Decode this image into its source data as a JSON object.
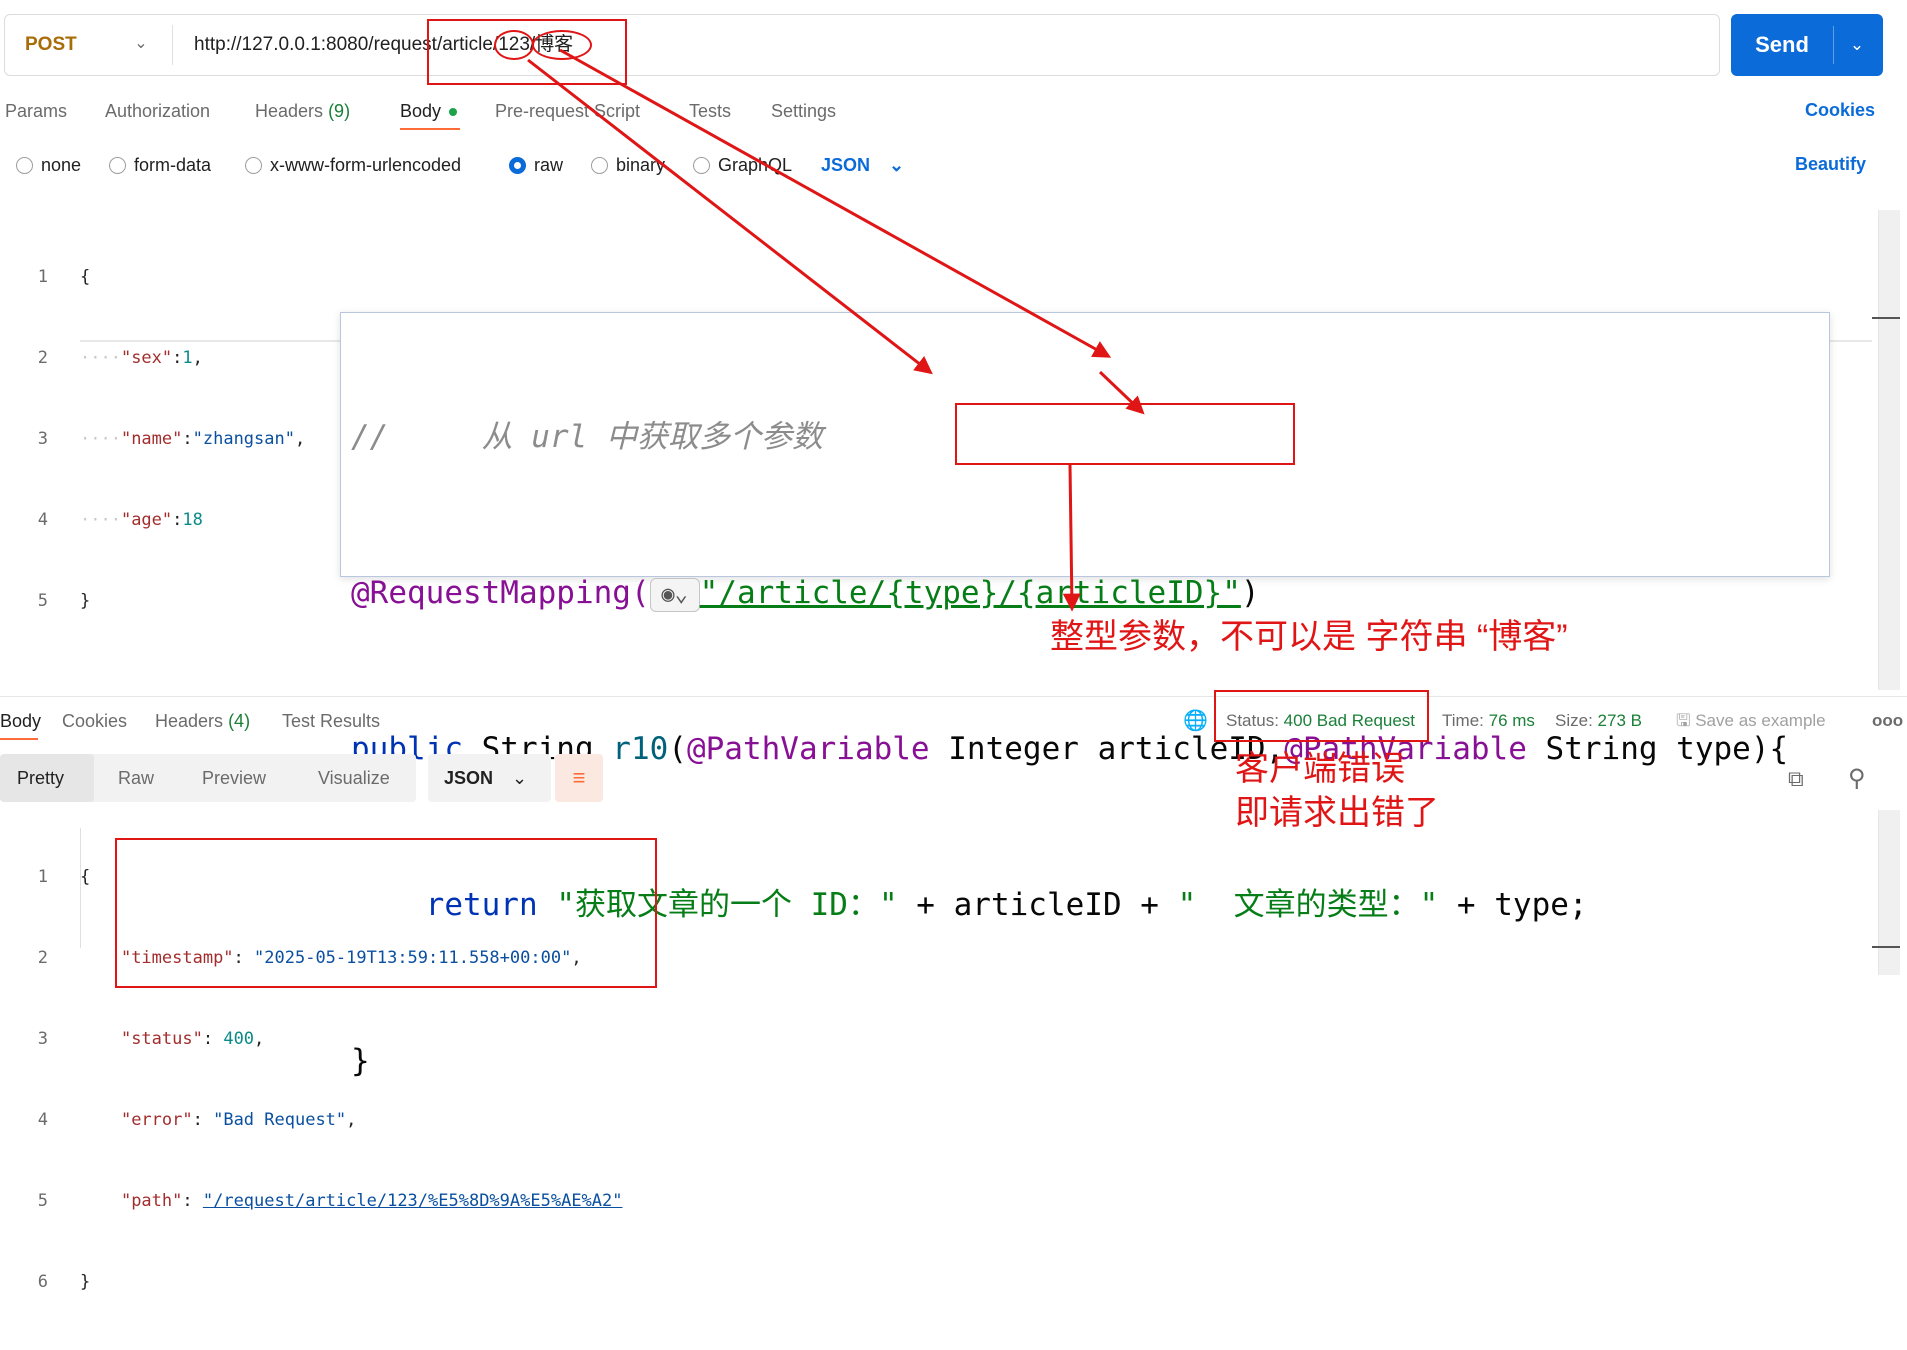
{
  "request": {
    "method": "POST",
    "url": "http://127.0.0.1:8080/request/article/123/博客",
    "send_label": "Send"
  },
  "request_tabs": [
    {
      "label": "Params"
    },
    {
      "label": "Authorization"
    },
    {
      "label": "Headers",
      "count": "(9)"
    },
    {
      "label": "Body"
    },
    {
      "label": "Pre-request Script"
    },
    {
      "label": "Tests"
    },
    {
      "label": "Settings"
    }
  ],
  "cookies_label": "Cookies",
  "body_modes": [
    "none",
    "form-data",
    "x-www-form-urlencoded",
    "raw",
    "binary",
    "GraphQL"
  ],
  "body_selected_mode": "raw",
  "body_format": "JSON",
  "beautify_label": "Beautify",
  "request_body_lines": [
    {
      "n": "1",
      "text": "{"
    },
    {
      "n": "2",
      "key": "\"sex\"",
      "val": "1",
      "tail": ","
    },
    {
      "n": "3",
      "key": "\"name\"",
      "val": "\"zhangsan\"",
      "tail": ","
    },
    {
      "n": "4",
      "key": "\"age\"",
      "val": "18",
      "tail": ""
    },
    {
      "n": "5",
      "text": "}"
    }
  ],
  "java_code": {
    "comment": "//     从 url 中获取多个参数",
    "annotation": "@RequestMapping(",
    "mapping_path": "\"/article/{type}/{articleID}\"",
    "mapping_close": ")",
    "line3_kw": "public",
    "line3_type": " String ",
    "line3_fn": "r10",
    "line3_paren": "(",
    "line3_ann1": "@PathVariable",
    "line3_param1": " Integer articleID",
    "line3_comma": ",",
    "line3_ann2": "@PathVariable",
    "line3_rest": " String type){",
    "line4_kw": "return",
    "line4_str1": "\"获取文章的一个 ID：\"",
    "line4_mid": " + articleID + ",
    "line4_str2": "\"  文章的类型：\"",
    "line4_end": " + type;",
    "line5": "}"
  },
  "response_tabs": [
    {
      "label": "Body"
    },
    {
      "label": "Cookies"
    },
    {
      "label": "Headers",
      "count": "(4)"
    },
    {
      "label": "Test Results"
    }
  ],
  "response_meta": {
    "status_label": "Status:",
    "status_value": "400 Bad Request",
    "time_label": "Time:",
    "time_value": "76 ms",
    "size_label": "Size:",
    "size_value": "273 B",
    "save_label": "Save as example",
    "more": "ooo"
  },
  "format_tabs": [
    "Pretty",
    "Raw",
    "Preview",
    "Visualize"
  ],
  "response_format": "JSON",
  "response_lines": [
    {
      "n": "1",
      "text": "{"
    },
    {
      "n": "2",
      "key": "\"timestamp\"",
      "val": "\"2025-05-19T13:59:11.558+00:00\"",
      "tail": ","
    },
    {
      "n": "3",
      "key": "\"status\"",
      "val": "400",
      "tail": ","
    },
    {
      "n": "4",
      "key": "\"error\"",
      "val": "\"Bad Request\"",
      "tail": ","
    },
    {
      "n": "5",
      "key": "\"path\"",
      "val": "\"/request/article/123/%E5%8D%9A%E5%AE%A2\"",
      "tail": ""
    },
    {
      "n": "6",
      "text": "}"
    }
  ],
  "annotations": {
    "type_note": "整型参数，不可以是 字符串 “博客”",
    "error_note_1": "客户端错误",
    "error_note_2": "即请求出错了"
  },
  "colors": {
    "accent": "#0b6bd8",
    "annotation_red": "#e01515",
    "postman_orange": "#ff6c37",
    "status_green": "#1a7f37"
  }
}
